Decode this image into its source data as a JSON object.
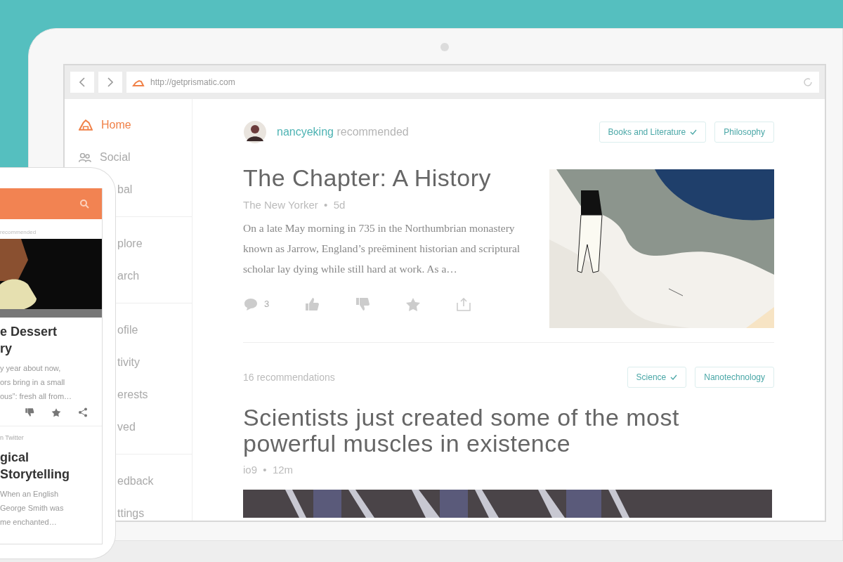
{
  "browser": {
    "url": "http://getprismatic.com"
  },
  "sidebar": {
    "groups": [
      {
        "items": [
          {
            "label": "Home",
            "kind": "home",
            "selected": true
          },
          {
            "label": "Social",
            "kind": "social",
            "selected": false
          },
          {
            "label": "bal",
            "selected": false
          }
        ]
      },
      {
        "items": [
          {
            "label": "plore",
            "selected": false
          },
          {
            "label": "arch",
            "selected": false
          }
        ]
      },
      {
        "items": [
          {
            "label": "ofile",
            "selected": false
          },
          {
            "label": "tivity",
            "selected": false
          },
          {
            "label": "erests",
            "selected": false
          },
          {
            "label": "ved",
            "selected": false
          }
        ]
      },
      {
        "items": [
          {
            "label": "edback",
            "selected": false
          },
          {
            "label": "ttings",
            "selected": false
          }
        ]
      }
    ]
  },
  "feed": [
    {
      "kind": "story",
      "user": "nancyeking",
      "action": "recommended",
      "tags": [
        {
          "label": "Books and Literature",
          "followed": true
        },
        {
          "label": "Philosophy",
          "followed": false
        }
      ],
      "title": "The Chapter: A History",
      "byline": "The New Yorker  •  5d",
      "excerpt": "On a late May morning in 735 in the Northumbrian monastery known as Jarrow, England’s preëminent historian and scriptural scholar lay dying while still hard at work. As a…",
      "comments": "3"
    },
    {
      "kind": "story_short",
      "count_text": "16 recommendations",
      "tags": [
        {
          "label": "Science",
          "followed": true
        },
        {
          "label": "Nanotechnology",
          "followed": false
        }
      ],
      "title": "Scientists just created some of the most powerful muscles in existence",
      "byline": "io9  •  12m"
    }
  ],
  "phone": {
    "label": "recommended",
    "cards": [
      {
        "title_lines": [
          "e Dessert",
          "ry"
        ],
        "body_lines": [
          "y year about now,",
          "ors bring in a small",
          "ous”: fresh all from…"
        ]
      },
      {
        "kind": "text",
        "source": "n Twitter",
        "title_lines": [
          "gical",
          "Storytelling"
        ],
        "body_lines": [
          "When an English",
          "George Smith was",
          "me enchanted…"
        ]
      }
    ]
  }
}
